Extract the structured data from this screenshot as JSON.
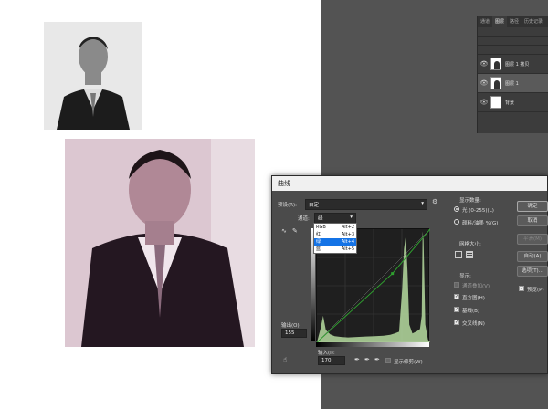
{
  "layers_panel": {
    "tabs": [
      "通道",
      "图层",
      "路径",
      "历史记录"
    ],
    "active_tab": 1,
    "layers": [
      {
        "name": "图层 1 拷贝",
        "selected": false
      },
      {
        "name": "图层 1",
        "selected": true
      },
      {
        "name": "背景",
        "selected": false
      }
    ]
  },
  "curves": {
    "title": "曲线",
    "preset_label": "预设(R):",
    "preset_value": "自定",
    "channel_label": "通道:",
    "channel_value": "绿",
    "channel_options": [
      {
        "label": "RGB",
        "shortcut": "Alt+2"
      },
      {
        "label": "红",
        "shortcut": "Alt+3"
      },
      {
        "label": "绿",
        "shortcut": "Alt+4"
      },
      {
        "label": "蓝",
        "shortcut": "Alt+5"
      }
    ],
    "selected_channel_index": 2,
    "output_label": "输出(O):",
    "output_value": "155",
    "input_label": "输入(I):",
    "input_value": "170",
    "show_clipping_label": "显示修剪(W)",
    "display_amount_label": "显示数量:",
    "light_label": "光 (0-255)(L)",
    "pigment_label": "颜料/油墨 %(G)",
    "grid_size_label": "网格大小:",
    "show_label": "显示:",
    "channel_overlay_label": "通道叠加(V)",
    "histogram_label": "直方图(H)",
    "baseline_label": "基线(B)",
    "intersection_label": "交叉线(N)",
    "buttons": {
      "ok": "确定",
      "cancel": "取消",
      "smooth": "平滑(M)",
      "auto": "自动(A)",
      "options": "选项(T)...",
      "preview": "预览(P)"
    }
  },
  "chart_data": {
    "type": "area",
    "title": "",
    "xlabel": "",
    "ylabel": "",
    "xlim": [
      0,
      255
    ],
    "ylim": [
      0,
      255
    ],
    "histogram": [
      [
        0,
        0
      ],
      [
        8,
        30
      ],
      [
        14,
        60
      ],
      [
        20,
        28
      ],
      [
        30,
        18
      ],
      [
        40,
        14
      ],
      [
        55,
        12
      ],
      [
        70,
        11
      ],
      [
        90,
        12
      ],
      [
        110,
        13
      ],
      [
        130,
        14
      ],
      [
        150,
        15
      ],
      [
        165,
        17
      ],
      [
        175,
        20
      ],
      [
        185,
        24
      ],
      [
        192,
        120
      ],
      [
        196,
        210
      ],
      [
        200,
        240
      ],
      [
        204,
        160
      ],
      [
        208,
        40
      ],
      [
        215,
        20
      ],
      [
        225,
        25
      ],
      [
        232,
        30
      ],
      [
        236,
        60
      ],
      [
        238,
        250
      ],
      [
        240,
        230
      ],
      [
        244,
        40
      ],
      [
        250,
        6
      ],
      [
        255,
        0
      ]
    ],
    "curve_points": [
      [
        0,
        0
      ],
      [
        170,
        155
      ],
      [
        255,
        255
      ]
    ],
    "colors": {
      "histogram": "#b6dca0",
      "curve": "#2f9e2f",
      "grid": "#3d3d3d"
    }
  }
}
